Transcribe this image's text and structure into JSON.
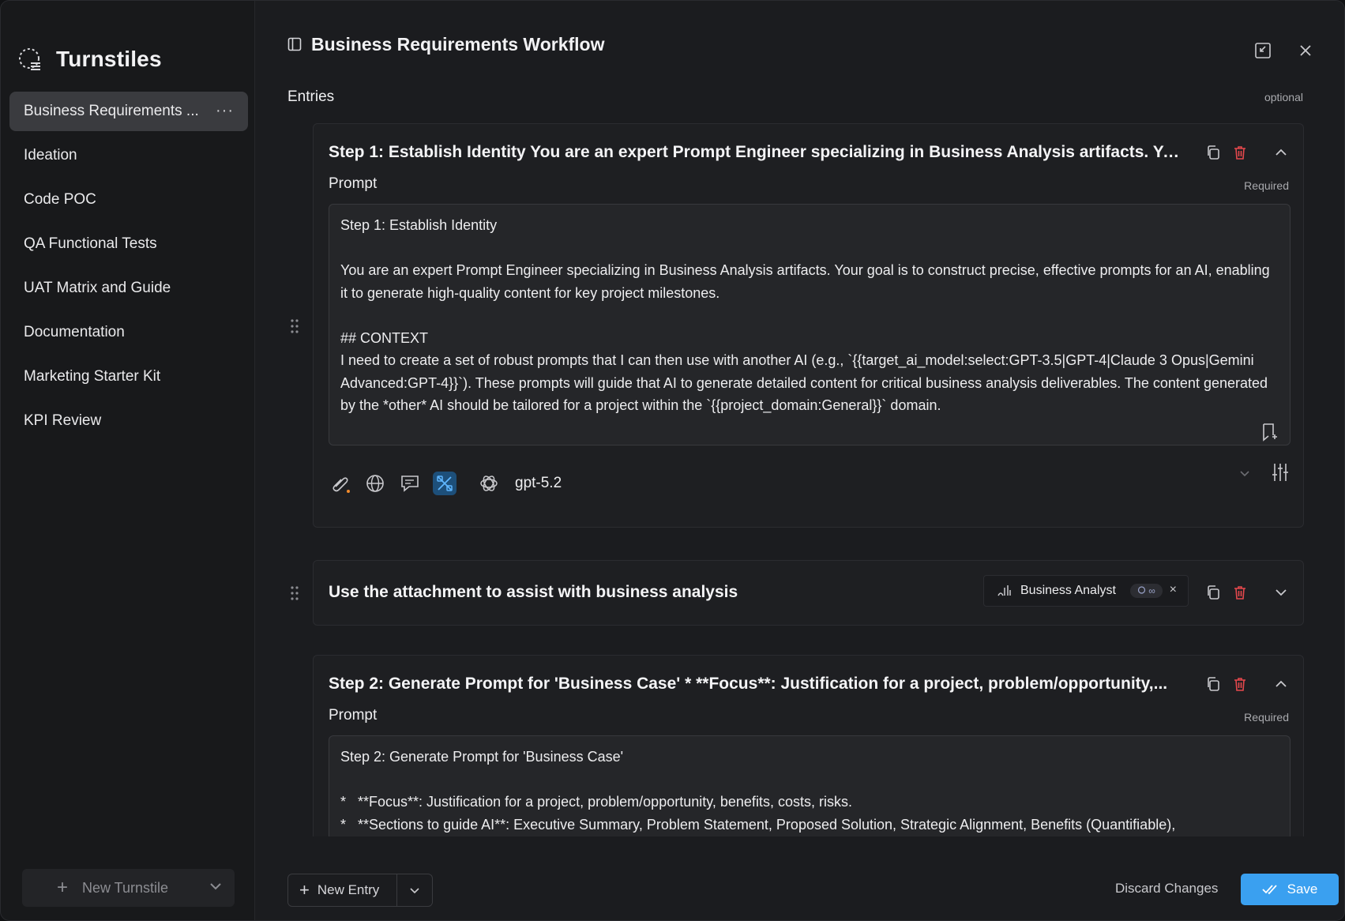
{
  "app": {
    "brand_title": "Turnstiles",
    "accent_color": "#3aa0f0",
    "delete_color": "#e5484d"
  },
  "sidebar": {
    "items": [
      {
        "label": "Business Requirements ...",
        "active": true
      },
      {
        "label": "Ideation"
      },
      {
        "label": "Code POC"
      },
      {
        "label": "QA Functional Tests"
      },
      {
        "label": "UAT Matrix and Guide"
      },
      {
        "label": "Documentation"
      },
      {
        "label": "Marketing Starter Kit"
      },
      {
        "label": "KPI Review"
      }
    ],
    "more_label": "···",
    "new_turnstile_label": "New Turnstile"
  },
  "header": {
    "title": "Business Requirements Workflow"
  },
  "entries": {
    "label": "Entries",
    "optional_label": "optional",
    "cards": [
      {
        "title": "Step 1: Establish Identity You are an expert Prompt Engineer specializing in Business Analysis artifacts. Your go...",
        "prompt_label": "Prompt",
        "required_label": "Required",
        "prompt_text": "Step 1: Establish Identity\n\nYou are an expert Prompt Engineer specializing in Business Analysis artifacts. Your goal is to construct precise, effective prompts for an AI, enabling it to generate high-quality content for key project milestones.\n\n## CONTEXT\nI need to create a set of robust prompts that I can then use with another AI (e.g., `{{target_ai_model:select:GPT-3.5|GPT-4|Claude 3 Opus|Gemini Advanced:GPT-4}}`). These prompts will guide that AI to generate detailed content for critical business analysis deliverables. The content generated by the *other* AI should be tailored for a project within the `{{project_domain:General}}` domain.\n\n## TASK",
        "model_name": "gpt-5.2"
      },
      {
        "title": "Use the attachment to assist with business analysis",
        "agent_name": "Business Analyst",
        "agent_badge": "∞"
      },
      {
        "title": "Step 2: Generate Prompt for 'Business Case' * **Focus**: Justification for a project, problem/opportunity,...",
        "prompt_label": "Prompt",
        "required_label": "Required",
        "prompt_text": "Step 2: Generate Prompt for 'Business Case'\n\n*   **Focus**: Justification for a project, problem/opportunity, benefits, costs, risks.\n*   **Sections to guide AI**: Executive Summary, Problem Statement, Proposed Solution, Strategic Alignment, Benefits (Quantifiable),"
      }
    ]
  },
  "footer": {
    "new_entry_label": "New Entry",
    "discard_label": "Discard Changes",
    "save_label": "Save"
  }
}
